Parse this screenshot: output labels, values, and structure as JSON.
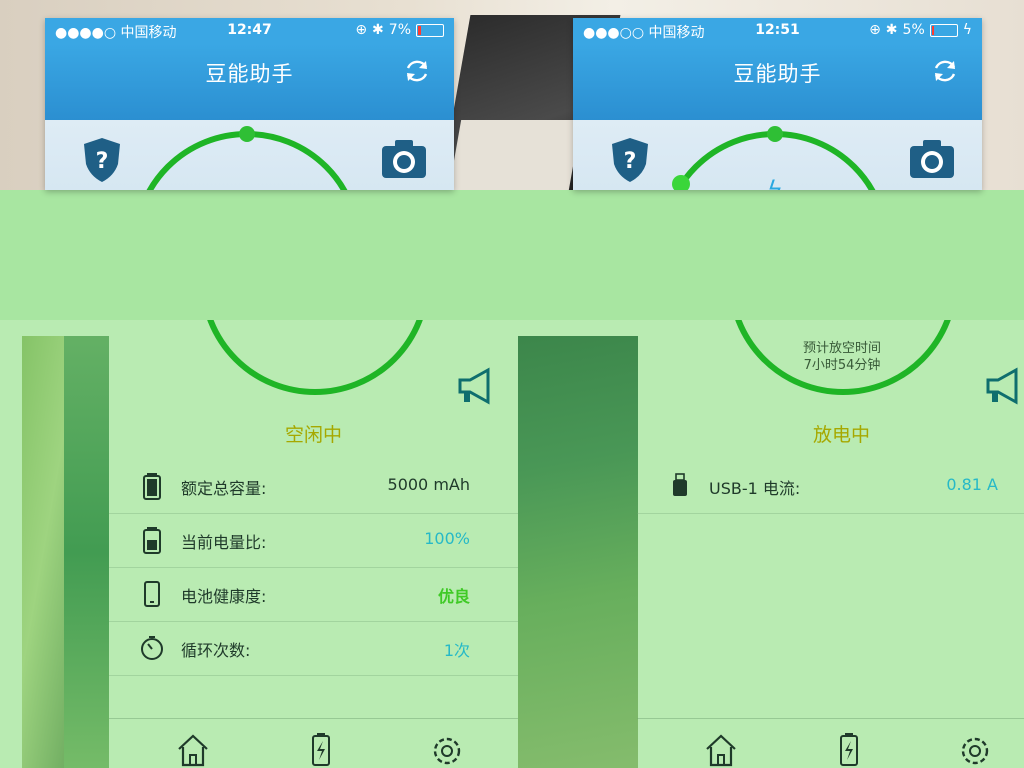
{
  "left_screen": {
    "statusbar": {
      "carrier": "●●●●○ 中国移动",
      "time": "12:47",
      "battery": "7%"
    },
    "app_title": "豆能助手",
    "state": "空闲中",
    "rows": [
      {
        "label": "额定总容量:",
        "value": "5000 mAh"
      },
      {
        "label": "当前电量比:",
        "value": "100%"
      },
      {
        "label": "电池健康度:",
        "value": "优良"
      },
      {
        "label": "循环次数:",
        "value": "1次"
      }
    ]
  },
  "right_screen": {
    "statusbar": {
      "carrier": "●●●○○ 中国移动",
      "time": "12:51",
      "battery": "5%"
    },
    "app_title": "豆能助手",
    "eta_label": "预计放空时间",
    "eta_value": "7小时54分钟",
    "state": "放电中",
    "rows": [
      {
        "label": "USB-1 电流:",
        "value": "0.81 A"
      }
    ]
  },
  "colors": {
    "nav_blue": "#2b8fd1",
    "ring_green": "#1fb526",
    "state_yellow": "#a6a800",
    "value_cyan": "#26b9c7",
    "value_green": "#3fca26",
    "icon_teal": "#0f6e6e"
  },
  "icons": [
    "refresh-icon",
    "help-shield-icon",
    "camera-icon",
    "megaphone-icon",
    "battery-full-icon",
    "battery-level-icon",
    "phone-icon",
    "timer-icon",
    "usb-icon",
    "home-icon",
    "charge-icon",
    "gear-icon"
  ]
}
